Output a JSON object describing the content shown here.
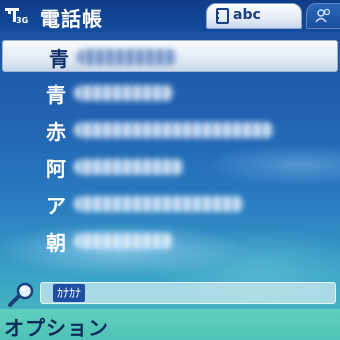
{
  "status": {
    "network": "3G"
  },
  "header": {
    "title": "電話帳",
    "tab_active_label": "abc",
    "tab_active_icon": "contacts-card-icon",
    "tab_inactive_icon": "groups-icon"
  },
  "contacts": [
    {
      "initial": "青",
      "selected": true
    },
    {
      "initial": "青",
      "selected": false
    },
    {
      "initial": "赤",
      "selected": false
    },
    {
      "initial": "阿",
      "selected": false
    },
    {
      "initial": "ア",
      "selected": false
    },
    {
      "initial": "朝",
      "selected": false
    }
  ],
  "search": {
    "mode_label": "ｶﾅｶﾅ",
    "value": ""
  },
  "softkeys": {
    "left": "オプション"
  },
  "colors": {
    "accent": "#1f4fa3",
    "header_bg": "#144c9d",
    "softkey_bg": "#4fc1b6"
  }
}
